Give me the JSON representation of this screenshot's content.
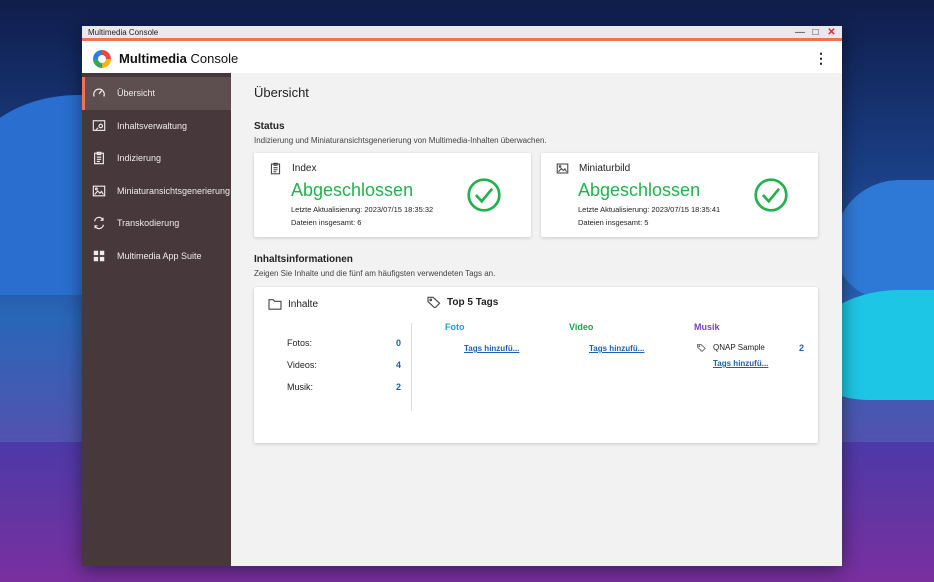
{
  "window": {
    "title": "Multimedia Console"
  },
  "app": {
    "name_bold": "Multimedia",
    "name_rest": " Console",
    "menu_icon": "kebab-icon"
  },
  "colors": {
    "accent": "#ef7350",
    "sidebar_bg": "#47393b",
    "success": "#22b14c",
    "link": "#1e5fb4",
    "photo": "#1a9fd9",
    "video": "#1aa64a",
    "music": "#7b3fbf"
  },
  "sidebar": {
    "items": [
      {
        "label": "Übersicht",
        "icon": "gauge-icon",
        "active": true
      },
      {
        "label": "Inhaltsverwaltung",
        "icon": "content-manage-icon"
      },
      {
        "label": "Indizierung",
        "icon": "clipboard-icon"
      },
      {
        "label": "Miniaturansichtsgenerierung",
        "icon": "image-icon"
      },
      {
        "label": "Transkodierung",
        "icon": "transcode-icon"
      },
      {
        "label": "Multimedia App Suite",
        "icon": "apps-grid-icon"
      }
    ]
  },
  "main": {
    "title": "Übersicht",
    "status": {
      "heading": "Status",
      "description": "Indizierung und Miniaturansichtsgenerierung von Multimedia-Inhalten überwachen.",
      "cards": [
        {
          "title": "Index",
          "state": "Abgeschlossen",
          "last_update": "Letzte Aktualisierung:  2023/07/15 18:35:32",
          "files": "Dateien insgesamt:  6"
        },
        {
          "title": "Miniaturbild",
          "state": "Abgeschlossen",
          "last_update": "Letzte Aktualisierung:  2023/07/15 18:35:41",
          "files": "Dateien insgesamt:  5"
        }
      ]
    },
    "content_info": {
      "heading": "Inhaltsinformationen",
      "description": "Zeigen Sie Inhalte und die fünf am häufigsten verwendeten Tags an.",
      "contents_title": "Inhalte",
      "counts": [
        {
          "label": "Fotos:",
          "value": "0"
        },
        {
          "label": "Videos:",
          "value": "4"
        },
        {
          "label": "Musik:",
          "value": "2"
        }
      ],
      "tags_title": "Top 5 Tags",
      "categories": [
        {
          "name": "Foto",
          "link": "Tags hinzufü..."
        },
        {
          "name": "Video",
          "link": "Tags hinzufü..."
        },
        {
          "name": "Musik",
          "tag": "QNAP Sample",
          "tag_count": "2",
          "link": "Tags hinzufü..."
        }
      ]
    }
  }
}
